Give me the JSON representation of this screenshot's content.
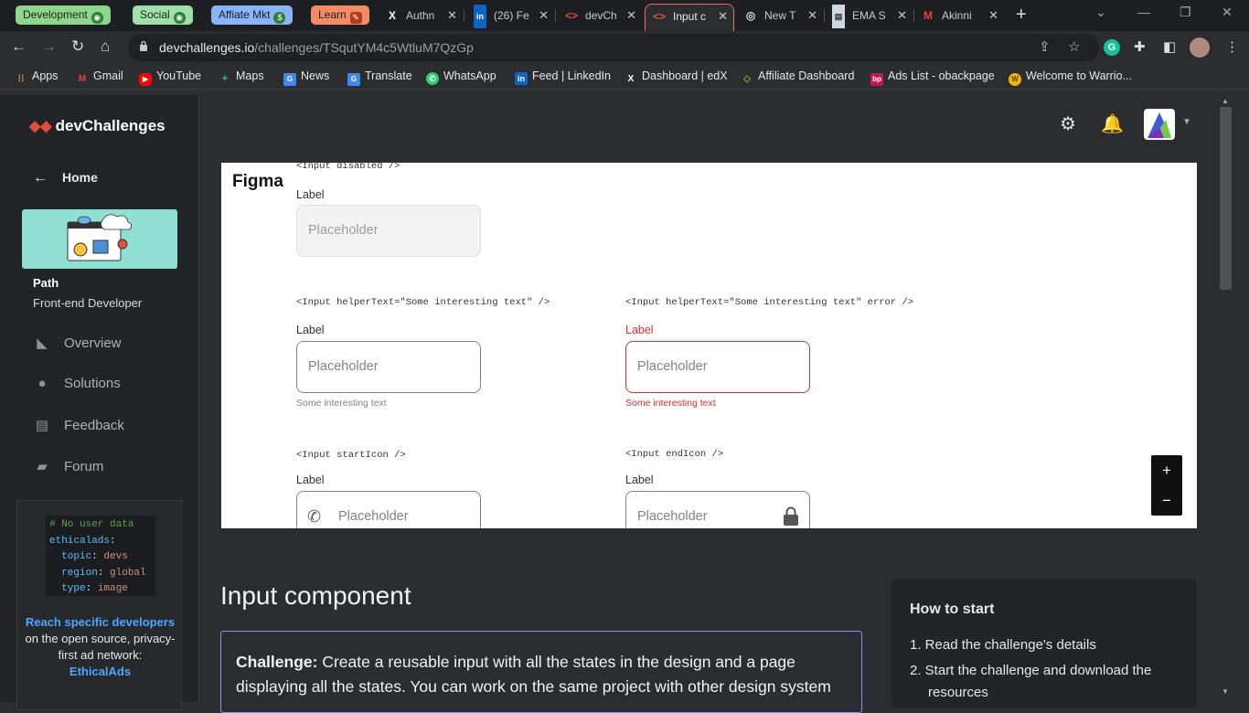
{
  "tab_groups": [
    {
      "label": "Development",
      "color": "#8ed68a"
    },
    {
      "label": "Social",
      "color": "#9fe0a8"
    },
    {
      "label": "Affiate Mkt",
      "color": "#8ab4f8"
    },
    {
      "label": "Learn",
      "color": "#f28b66"
    }
  ],
  "tabs": [
    {
      "title": "Authn",
      "icon": "x-logo-icon"
    },
    {
      "title": "(26) Fe",
      "icon": "linkedin-icon"
    },
    {
      "title": "devCh",
      "icon": "devchallenges-icon"
    },
    {
      "title": "Input c",
      "icon": "devchallenges-icon",
      "active": true
    },
    {
      "title": "New T",
      "icon": "chrome-icon"
    },
    {
      "title": "EMA S",
      "icon": "doc-icon"
    },
    {
      "title": "Akinni",
      "icon": "gmail-icon"
    }
  ],
  "address": {
    "domain": "devchallenges.io",
    "path": "/challenges/TSqutYM4c5WtluM7QzGp"
  },
  "bookmarks": [
    {
      "label": "Apps",
      "icon": "apps-grid-icon",
      "color": "#e8a33d"
    },
    {
      "label": "Gmail",
      "icon": "gmail-icon",
      "color": "#ea4335"
    },
    {
      "label": "YouTube",
      "icon": "youtube-icon",
      "color": "#ff0000"
    },
    {
      "label": "Maps",
      "icon": "maps-icon",
      "color": "#34a853"
    },
    {
      "label": "News",
      "icon": "news-icon",
      "color": "#4285f4"
    },
    {
      "label": "Translate",
      "icon": "translate-icon",
      "color": "#4285f4"
    },
    {
      "label": "WhatsApp",
      "icon": "whatsapp-icon",
      "color": "#25d366"
    },
    {
      "label": "Feed | LinkedIn",
      "icon": "linkedin-icon",
      "color": "#0a66c2"
    },
    {
      "label": "Dashboard | edX",
      "icon": "x-logo-icon",
      "color": "#ffffff"
    },
    {
      "label": "Affiliate Dashboard",
      "icon": "affiliate-icon",
      "color": "#5bc236"
    },
    {
      "label": "Ads List - obackpage",
      "icon": "bp-icon",
      "color": "#c2185b"
    },
    {
      "label": "Welcome to Warrio...",
      "icon": "warrior-icon",
      "color": "#f4b400"
    }
  ],
  "sidebar": {
    "brand": "devChallenges",
    "home": "Home",
    "path_label": "Path",
    "path_name": "Front-end Developer",
    "items": [
      {
        "label": "Overview",
        "icon": "overview-icon"
      },
      {
        "label": "Solutions",
        "icon": "lightbulb-icon"
      },
      {
        "label": "Feedback",
        "icon": "feedback-icon"
      },
      {
        "label": "Forum",
        "icon": "forum-icon"
      }
    ],
    "ad": {
      "code_comment": "# No user data",
      "code_key": "ethicalads",
      "code_lines": [
        {
          "k": "topic",
          "v": "devs"
        },
        {
          "k": "region",
          "v": "global"
        },
        {
          "k": "type",
          "v": "image"
        }
      ],
      "text_bold": "Reach specific developers",
      "text_rest": " on the open source, privacy-first ad network:",
      "text_link": "EthicalAds"
    }
  },
  "figma": {
    "label": "Figma",
    "disabled_tag": "<Input disabled />",
    "label_text": "Label",
    "placeholder": "Placeholder",
    "helper_tag": "<Input helperText=\"Some interesting text\" />",
    "helper_error_tag": "<Input helperText=\"Some interesting text\" error />",
    "helper_text": "Some interesting text",
    "start_icon_tag": "<Input startIcon />",
    "end_icon_tag": "<Input endIcon />",
    "zoom_in": "+",
    "zoom_out": "−"
  },
  "page": {
    "title": "Input component",
    "challenge_bold": "Challenge:",
    "challenge_text": " Create a reusable input with all the states in the design and a page displaying all the states. You can work on the same project with other design system"
  },
  "howto": {
    "title": "How to start",
    "steps": [
      "1. Read the challenge's details",
      "2. Start the challenge and download the resources"
    ]
  }
}
